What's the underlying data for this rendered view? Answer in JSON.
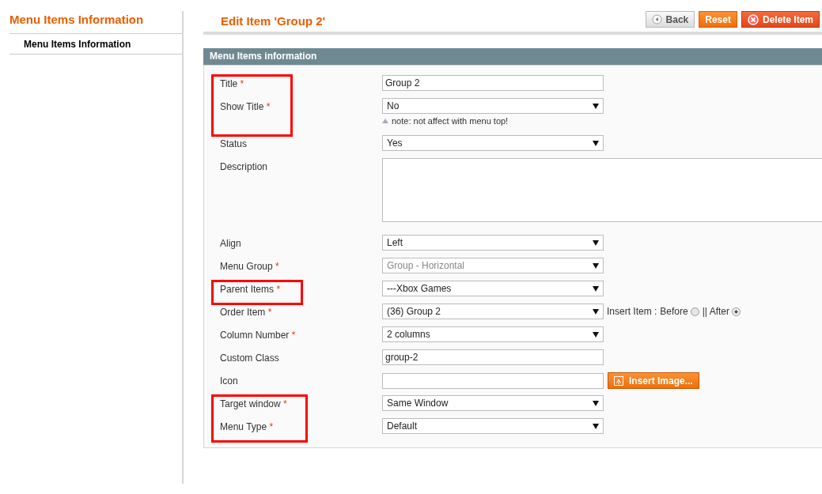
{
  "sidebar": {
    "title": "Menu Items Information",
    "items": [
      {
        "label": "Menu Items Information",
        "selected": true
      }
    ]
  },
  "header": {
    "title": "Edit Item 'Group 2'",
    "buttons": [
      {
        "kind": "back",
        "label": "Back"
      },
      {
        "kind": "reset",
        "label": "Reset"
      },
      {
        "kind": "delete",
        "label": "Delete Item"
      }
    ]
  },
  "section": {
    "title": "Menu Items information",
    "groups": [
      {
        "highlighted": true,
        "fields": [
          {
            "kind": "text",
            "label": "Title",
            "required": "*",
            "value": "Group 2"
          },
          {
            "kind": "select",
            "label": "Show Title",
            "required": "*",
            "value": "No",
            "note": "note: not affect with menu top!"
          }
        ]
      },
      {
        "highlighted": false,
        "fields": [
          {
            "kind": "select",
            "label": "Status",
            "value": "Yes"
          },
          {
            "kind": "textarea",
            "label": "Description"
          },
          {
            "kind": "select",
            "label": "Align",
            "value": "Left"
          },
          {
            "kind": "select",
            "label": "Menu Group",
            "required": "*",
            "value": "Group - Horizontal",
            "disabled": true
          }
        ]
      },
      {
        "highlighted": true,
        "fields": [
          {
            "kind": "select",
            "label": "Parent Items",
            "required": "*",
            "value": "---Xbox Games"
          }
        ]
      },
      {
        "highlighted": false,
        "fields": [
          {
            "kind": "select",
            "label": "Order Item",
            "required": "*",
            "value": "(36) Group 2",
            "insert": {
              "prefix": "Insert Item :",
              "options": [
                {
                  "label": "Before",
                  "selected": false
                },
                {
                  "label": "|| After",
                  "selected": true
                }
              ]
            }
          },
          {
            "kind": "select",
            "label": "Column Number",
            "required": "*",
            "value": "2 columns"
          },
          {
            "kind": "text",
            "label": "Custom Class",
            "value": "group-2"
          },
          {
            "kind": "image",
            "label": "Icon",
            "button": "Insert Image..."
          }
        ]
      },
      {
        "highlighted": true,
        "fields": [
          {
            "kind": "select",
            "label": "Target window",
            "required": "*",
            "value": "Same Window"
          },
          {
            "kind": "select",
            "label": "Menu Type",
            "required": "*",
            "value": "Default"
          }
        ]
      }
    ]
  }
}
